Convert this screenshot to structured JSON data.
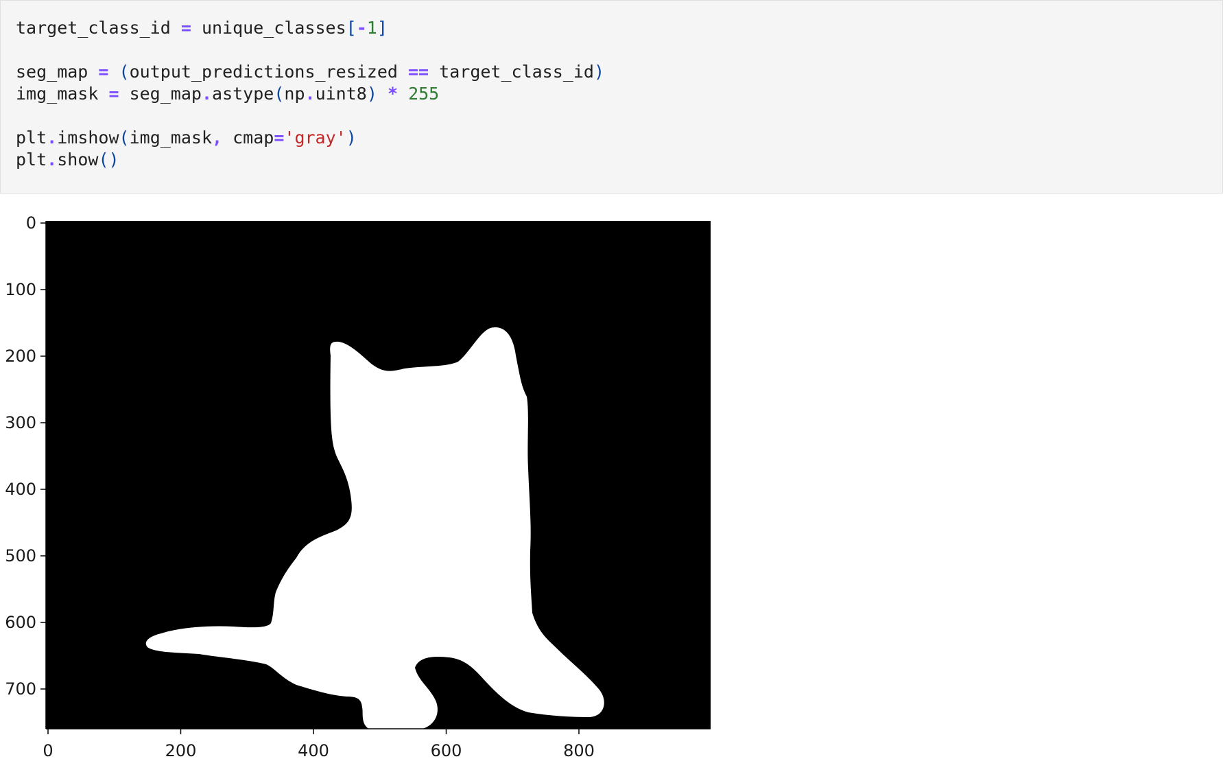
{
  "code": {
    "lines": [
      [
        [
          "ident",
          "target_class_id "
        ],
        [
          "op",
          "="
        ],
        [
          "ident",
          " unique_classes"
        ],
        [
          "paren",
          "["
        ],
        [
          "op",
          "-"
        ],
        [
          "num",
          "1"
        ],
        [
          "paren",
          "]"
        ]
      ],
      [],
      [
        [
          "ident",
          "seg_map "
        ],
        [
          "op",
          "="
        ],
        [
          "ident",
          " "
        ],
        [
          "paren",
          "("
        ],
        [
          "ident",
          "output_predictions_resized "
        ],
        [
          "op",
          "=="
        ],
        [
          "ident",
          " target_class_id"
        ],
        [
          "paren",
          ")"
        ]
      ],
      [
        [
          "ident",
          "img_mask "
        ],
        [
          "op",
          "="
        ],
        [
          "ident",
          " seg_map"
        ],
        [
          "op",
          "."
        ],
        [
          "ident",
          "astype"
        ],
        [
          "paren",
          "("
        ],
        [
          "ident",
          "np"
        ],
        [
          "op",
          "."
        ],
        [
          "ident",
          "uint8"
        ],
        [
          "paren",
          ")"
        ],
        [
          "ident",
          " "
        ],
        [
          "op",
          "*"
        ],
        [
          "ident",
          " "
        ],
        [
          "num",
          "255"
        ]
      ],
      [],
      [
        [
          "ident",
          "plt"
        ],
        [
          "op",
          "."
        ],
        [
          "ident",
          "imshow"
        ],
        [
          "paren",
          "("
        ],
        [
          "ident",
          "img_mask"
        ],
        [
          "op",
          ","
        ],
        [
          "ident",
          " cmap"
        ],
        [
          "op",
          "="
        ],
        [
          "str",
          "'gray'"
        ],
        [
          "paren",
          ")"
        ]
      ],
      [
        [
          "ident",
          "plt"
        ],
        [
          "op",
          "."
        ],
        [
          "ident",
          "show"
        ],
        [
          "paren",
          "()"
        ]
      ]
    ]
  },
  "output": {
    "image_description_icon": "segmentation-mask-image",
    "x_ticks": [
      "0",
      "200",
      "400",
      "600",
      "800"
    ],
    "y_ticks": [
      "0",
      "100",
      "200",
      "300",
      "400",
      "500",
      "600",
      "700"
    ]
  },
  "colors": {
    "code_background": "#f5f5f5",
    "operator": "#7c4dff",
    "number": "#2e7d32",
    "string": "#c62828",
    "paren": "#0d47a1",
    "mask_foreground": "#ffffff",
    "mask_background": "#000000"
  }
}
